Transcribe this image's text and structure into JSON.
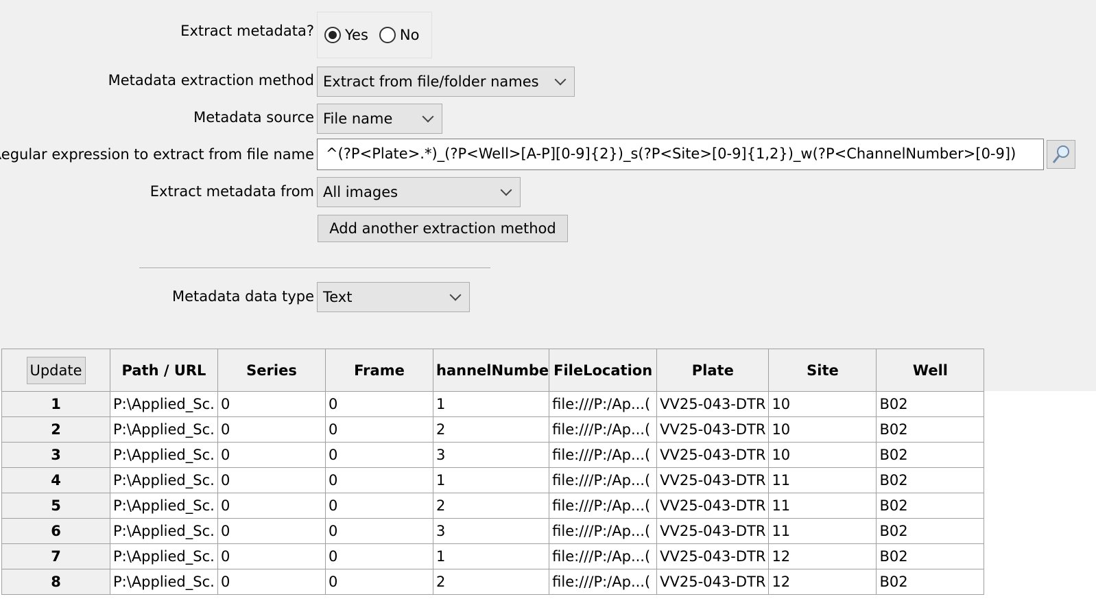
{
  "extract_metadata": {
    "label": "Extract metadata?",
    "options": [
      "Yes",
      "No"
    ],
    "selected": "Yes"
  },
  "method": {
    "label": "Metadata extraction method",
    "value": "Extract from file/folder names"
  },
  "source": {
    "label": "Metadata source",
    "value": "File name"
  },
  "regex": {
    "label": "Regular expression to extract from file name",
    "value": "^(?P<Plate>.*)_(?P<Well>[A-P][0-9]{2})_s(?P<Site>[0-9]{1,2})_w(?P<ChannelNumber>[0-9])"
  },
  "extract_from": {
    "label": "Extract metadata from",
    "value": "All images"
  },
  "add_button": "Add another extraction method",
  "data_type": {
    "label": "Metadata data type",
    "value": "Text"
  },
  "table": {
    "update_label": "Update",
    "headers": [
      "Path / URL",
      "Series",
      "Frame",
      "hannelNumbe",
      "FileLocation",
      "Plate",
      "Site",
      "Well"
    ],
    "rows": [
      [
        "1",
        "P:\\Applied_Sc.",
        "0",
        "0",
        "1",
        "file:///P:/Ap...(",
        "VV25-043-DTR",
        "10",
        "B02"
      ],
      [
        "2",
        "P:\\Applied_Sc.",
        "0",
        "0",
        "2",
        "file:///P:/Ap...(",
        "VV25-043-DTR",
        "10",
        "B02"
      ],
      [
        "3",
        "P:\\Applied_Sc.",
        "0",
        "0",
        "3",
        "file:///P:/Ap...(",
        "VV25-043-DTR",
        "10",
        "B02"
      ],
      [
        "4",
        "P:\\Applied_Sc.",
        "0",
        "0",
        "1",
        "file:///P:/Ap...(",
        "VV25-043-DTR",
        "11",
        "B02"
      ],
      [
        "5",
        "P:\\Applied_Sc.",
        "0",
        "0",
        "2",
        "file:///P:/Ap...(",
        "VV25-043-DTR",
        "11",
        "B02"
      ],
      [
        "6",
        "P:\\Applied_Sc.",
        "0",
        "0",
        "3",
        "file:///P:/Ap...(",
        "VV25-043-DTR",
        "11",
        "B02"
      ],
      [
        "7",
        "P:\\Applied_Sc.",
        "0",
        "0",
        "1",
        "file:///P:/Ap...(",
        "VV25-043-DTR",
        "12",
        "B02"
      ],
      [
        "8",
        "P:\\Applied_Sc.",
        "0",
        "0",
        "2",
        "file:///P:/Ap...(",
        "VV25-043-DTR",
        "12",
        "B02"
      ]
    ]
  }
}
